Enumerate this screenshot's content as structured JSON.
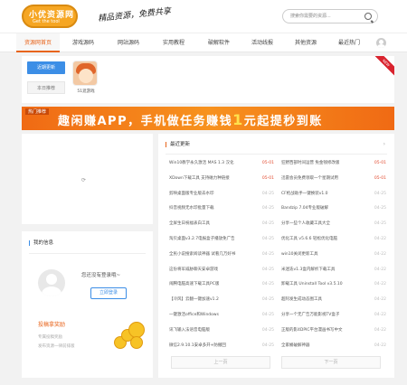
{
  "header": {
    "logo_text": "小优资源网",
    "logo_sub": "Get the tool",
    "slogan": "精品资源，免费共享",
    "search_placeholder": "搜索你需要的资源..."
  },
  "nav": {
    "items": [
      "资源网首页",
      "游戏源码",
      "网站源码",
      "实用教程",
      "破解软件",
      "活动线报",
      "其他资源",
      "最近热门"
    ],
    "active_index": 0
  },
  "top": {
    "primary_btn": "近期更新",
    "secondary_btn": "本日推荐",
    "app_label": "51逛游戏",
    "ribbon": "NEW"
  },
  "banner": {
    "tag": "热门推荐",
    "text_a": "趣闲赚APP，手机做任务赚钱",
    "text_hl": "1",
    "text_b": "元起提秒到账"
  },
  "loading": {
    "spinner": "⟳"
  },
  "user_card": {
    "title": "我的信息",
    "login_text": "您还没有登录哦~",
    "login_btn": "立即登录",
    "reward_title": "投稿拿奖励",
    "reward_line1": "专属投稿奖励",
    "reward_line2": "发布资源一律前排版"
  },
  "list": {
    "title": "最近更新",
    "more": "›",
    "left": [
      {
        "title": "Win10教学永久激活 MAS 1.3 汉化",
        "date": "05-01",
        "red": true
      },
      {
        "title": "XDown下载工具 支持磁力种链接",
        "date": "05-01",
        "red": true
      },
      {
        "title": "剪映桌面版专业版去水印",
        "date": "04-25",
        "red": false
      },
      {
        "title": "抖音视频无水印批量下载",
        "date": "04-25",
        "red": false
      },
      {
        "title": "全屏生日祝福表白工具",
        "date": "04-25",
        "red": false
      },
      {
        "title": "淘贝桌面v3.2.7电报盒子播放免广告",
        "date": "04-25",
        "red": false
      },
      {
        "title": "全民小说搜索阅读神器 试看几万好书",
        "date": "04-25",
        "red": false
      },
      {
        "title": "这份将军威胁聊天安卓游戏",
        "date": "04-25",
        "red": false
      },
      {
        "title": "闹腾电脑高速下载工具PC版",
        "date": "04-25",
        "red": false
      },
      {
        "title": "【冷风】云翻一键加速v1.2",
        "date": "04-25",
        "red": false
      },
      {
        "title": "一键激活office和Windows",
        "date": "04-25",
        "red": false
      },
      {
        "title": "讯飞输入法语音电脑版",
        "date": "04-25",
        "red": false
      },
      {
        "title": "微信2.9.10.1安卓多开+防撤回",
        "date": "04-25",
        "red": false
      }
    ],
    "right": [
      {
        "title": "狂野西部时间运营 免金钱修改版",
        "date": "05-01",
        "red": true
      },
      {
        "title": "迅雷会员免费领取一个星期试用",
        "date": "05-01",
        "red": true
      },
      {
        "title": "CF枪战助手一键换装v1.0",
        "date": "04-25",
        "red": false
      },
      {
        "title": "Bandzip 7.04专业版破解",
        "date": "04-25",
        "red": false
      },
      {
        "title": "分享一些个人收藏工具大全",
        "date": "04-25",
        "red": false
      },
      {
        "title": "优化工具 v5.6.6 轻松优化电脑",
        "date": "04-22",
        "red": false
      },
      {
        "title": "win10关闭更新工具",
        "date": "04-22",
        "red": false
      },
      {
        "title": "米迷迭v1.3盒内解析下载工具",
        "date": "04-22",
        "red": false
      },
      {
        "title": "卸载工具 Uninstall Tool v3.5.10",
        "date": "04-22",
        "red": false
      },
      {
        "title": "超阿发生成动态图工具",
        "date": "04-22",
        "red": false
      },
      {
        "title": "分享一个无广告万能影视TV盒子",
        "date": "04-22",
        "red": false
      },
      {
        "title": "正版的影4DPIC平台漫画书写中文",
        "date": "04-22",
        "red": false
      },
      {
        "title": "全家桶破解神器",
        "date": "04-22",
        "red": false
      }
    ],
    "prev": "上一页",
    "next": "下一页"
  }
}
